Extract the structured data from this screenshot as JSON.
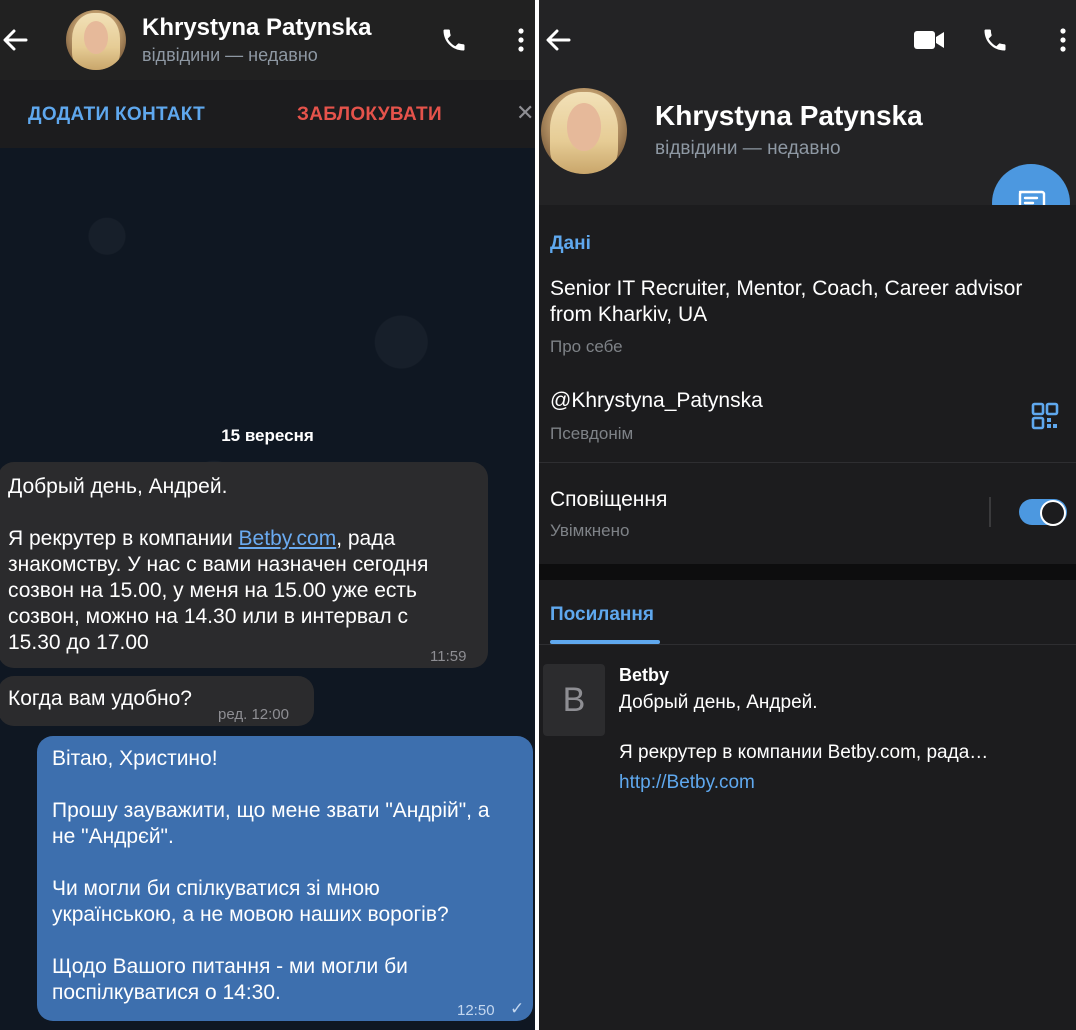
{
  "chat": {
    "header": {
      "name": "Khrystyna Patynska",
      "status": "відвідини — недавно"
    },
    "actions": {
      "add_contact": "ДОДАТИ КОНТАКТ",
      "block": "ЗАБЛОКУВАТИ",
      "close": "✕"
    },
    "date_separator": "15 вересня",
    "messages": [
      {
        "direction": "incoming",
        "text_before_link": "Добрый день, Андрей.\n\nЯ рекрутер в компании ",
        "link": "Betby.com",
        "text_after_link": ", рада\nзнакомству. У нас с вами назначен сегодня\nсозвон на 15.00, у меня на 15.00 уже есть\nсозвон, можно на 14.30 или в интервал с\n15.30 до 17.00",
        "time": "11:59"
      },
      {
        "direction": "incoming",
        "text": "Когда вам удобно?",
        "time": "ред. 12:00"
      },
      {
        "direction": "outgoing",
        "text": "Вітаю, Христино!\n\nПрошу зауважити, що мене звати \"Андрій\", а\nне \"Андрєй\".\n\nЧи могли би спілкуватися зі мною\nукраїнською, а не мовою наших ворогів?\n\nЩодо Вашого питання - ми могли би\nпоспілкуватися о 14:30.",
        "time": "12:50",
        "read": "✓"
      }
    ]
  },
  "profile": {
    "name": "Khrystyna Patynska",
    "status": "відвідини — недавно",
    "info_section_title": "Дані",
    "bio": "Senior IT Recruiter, Mentor, Coach, Career advisor\nfrom Kharkiv, UA",
    "bio_label": "Про себе",
    "username": "@Khrystyna_Patynska",
    "username_label": "Псевдонім",
    "notifications": "Сповіщення",
    "notifications_state": "Увімкнено",
    "notifications_enabled": true,
    "links_tab": "Посилання",
    "link_item": {
      "thumb_letter": "B",
      "title": "Betby",
      "line1": "Добрый день, Андрей.",
      "line2": "Я рекрутер в компании Betby.com, рада…",
      "url": "http://Betby.com"
    }
  },
  "colors": {
    "accent_blue": "#5fa8ee",
    "block_red": "#e5534b",
    "outgoing_bubble": "#3d6fae",
    "incoming_bubble": "#2b2b2d"
  },
  "icons": [
    "back-arrow-icon",
    "phone-icon",
    "more-vert-icon",
    "video-icon",
    "message-icon",
    "qr-code-icon",
    "close-icon"
  ]
}
